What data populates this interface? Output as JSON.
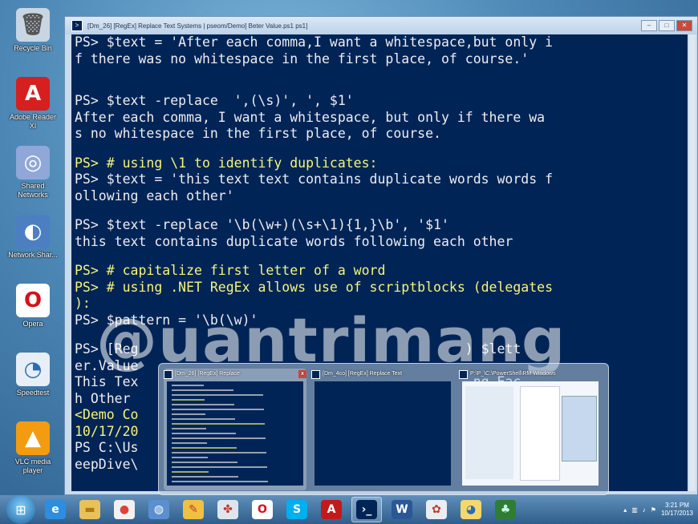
{
  "desktop_icons": [
    {
      "name": "recycle-bin-icon",
      "glyph": "🗑",
      "label": "Recycle Bin",
      "bg": "#c8d6e4",
      "color": "#555"
    },
    {
      "name": "adobe-reader-icon",
      "glyph": "A",
      "label": "Adobe Reader XI",
      "bg": "#d61f1f",
      "color": "#fff"
    },
    {
      "name": "shared-network-icon",
      "glyph": "◎",
      "label": "Shared Networks",
      "bg": "#8fa8d8",
      "color": "#fff"
    },
    {
      "name": "network-app-icon",
      "glyph": "◐",
      "label": "Network Shar...",
      "bg": "#4c7fc2",
      "color": "#fff"
    },
    {
      "name": "opera-icon",
      "glyph": "O",
      "label": "Opera",
      "bg": "#ffffff",
      "color": "#d4111a"
    },
    {
      "name": "speedtest-icon",
      "glyph": "◔",
      "label": "Speedtest",
      "bg": "#e7eef5",
      "color": "#2a6bb5"
    },
    {
      "name": "vlc-icon",
      "glyph": "▲",
      "label": "VLC media player",
      "bg": "#f39c12",
      "color": "#fff"
    }
  ],
  "window": {
    "title": "[Dm_26]  [RegEx] Replace Text  Systems | pseom/Demo] Beter Value.ps1 ps1]",
    "controls": [
      "–",
      "□",
      "✕"
    ]
  },
  "console_lines": [
    {
      "text": "PS> $text = 'After each comma,I want a whitespace,but only i",
      "yellow": false
    },
    {
      "text": "f there was no whitespace in the first place, of course.'",
      "yellow": false
    },
    {
      "text": "",
      "yellow": false,
      "blank": true
    },
    {
      "text": "",
      "yellow": false,
      "blank": true
    },
    {
      "text": "PS> $text -replace  ',(\\s)', ', $1'",
      "yellow": false
    },
    {
      "text": "After each comma, I want a whitespace, but only if there wa",
      "yellow": false
    },
    {
      "text": "s no whitespace in the first place, of course.",
      "yellow": false
    },
    {
      "text": "",
      "yellow": false,
      "blank": true
    },
    {
      "text": "PS> # using \\1 to identify duplicates:",
      "yellow": true
    },
    {
      "text": "PS> $text = 'this text text contains duplicate words words f",
      "yellow": false
    },
    {
      "text": "ollowing each other'",
      "yellow": false
    },
    {
      "text": "",
      "yellow": false,
      "blank": true
    },
    {
      "text": "PS> $text -replace '\\b(\\w+)(\\s+\\1){1,}\\b', '$1'",
      "yellow": false
    },
    {
      "text": "this text contains duplicate words following each other",
      "yellow": false
    },
    {
      "text": "",
      "yellow": false,
      "blank": true
    },
    {
      "text": "PS> # capitalize first letter of a word",
      "yellow": true
    },
    {
      "text": "PS> # using .NET RegEx allows use of scriptblocks (delegates",
      "yellow": true
    },
    {
      "text": "):",
      "yellow": true
    },
    {
      "text": "PS> $pattern = '\\b(\\w)'",
      "yellow": false
    },
    {
      "text": "",
      "yellow": false,
      "blank": true
    },
    {
      "text": "PS> [Reg                                         ) $lett",
      "yellow": false
    },
    {
      "text": "er.Value",
      "yellow": false
    },
    {
      "text": "This Tex                                          ng Eac",
      "yellow": false
    },
    {
      "text": "h Other",
      "yellow": false
    },
    {
      "text": "<Demo Co",
      "yellow": true
    },
    {
      "text": "10/17/20",
      "yellow": true
    },
    {
      "text": "PS C:\\Us                                          urt - D",
      "yellow": false
    },
    {
      "text": "eepDive\\",
      "yellow": false
    }
  ],
  "watermark": "@uantrimang",
  "thumbnails": [
    {
      "name": "thumb-console-1",
      "title": "[Dm_26]  [RegEx] Replace",
      "close": "x",
      "kind": "console"
    },
    {
      "name": "thumb-console-2",
      "title": "[Dm_4co]  [RegEx] Replace Text",
      "close": "",
      "kind": "console-dark"
    },
    {
      "name": "thumb-explorer",
      "title": "P:\\P_\\C:\\PowerShell\\RM Windows",
      "close": "",
      "kind": "explorer"
    }
  ],
  "taskbar": {
    "items": [
      {
        "name": "ie-icon",
        "glyph": "e",
        "bg": "#2d8de0",
        "color": "#fff",
        "active": false
      },
      {
        "name": "explorer-folder-icon",
        "glyph": "▬",
        "bg": "#e8c15a",
        "color": "#b07a12",
        "active": false
      },
      {
        "name": "chrome-icon",
        "glyph": "●",
        "bg": "#f1f1f1",
        "color": "#db4437",
        "active": false
      },
      {
        "name": "network-icon",
        "glyph": "◍",
        "bg": "#5a8fd0",
        "color": "#fff",
        "active": false
      },
      {
        "name": "ms-paint-icon",
        "glyph": "✎",
        "bg": "#f0c040",
        "color": "#c0392b",
        "active": false
      },
      {
        "name": "maze-app-icon",
        "glyph": "✤",
        "bg": "#dde6ee",
        "color": "#c0392b",
        "active": false
      },
      {
        "name": "opera-taskbar-icon",
        "glyph": "O",
        "bg": "#ffffff",
        "color": "#d4111a",
        "active": false
      },
      {
        "name": "skype-icon",
        "glyph": "S",
        "bg": "#00aff0",
        "color": "#fff",
        "active": false
      },
      {
        "name": "acrobat-icon",
        "glyph": "A",
        "bg": "#c21a1a",
        "color": "#fff",
        "active": false
      },
      {
        "name": "powershell-icon",
        "glyph": "›_",
        "bg": "#012456",
        "color": "#fff",
        "active": true
      },
      {
        "name": "word-icon",
        "glyph": "W",
        "bg": "#2b5797",
        "color": "#fff",
        "active": false
      },
      {
        "name": "paint-app-icon",
        "glyph": "✿",
        "bg": "#e9eef3",
        "color": "#c0392b",
        "active": false
      },
      {
        "name": "chart-app-icon",
        "glyph": "◕",
        "bg": "#f5d76e",
        "color": "#2a6bb5",
        "active": false
      },
      {
        "name": "plant-app-icon",
        "glyph": "♣",
        "bg": "#2e7d32",
        "color": "#cfe",
        "active": false
      }
    ],
    "clock_time": "3:21 PM",
    "clock_date": "10/17/2013"
  }
}
